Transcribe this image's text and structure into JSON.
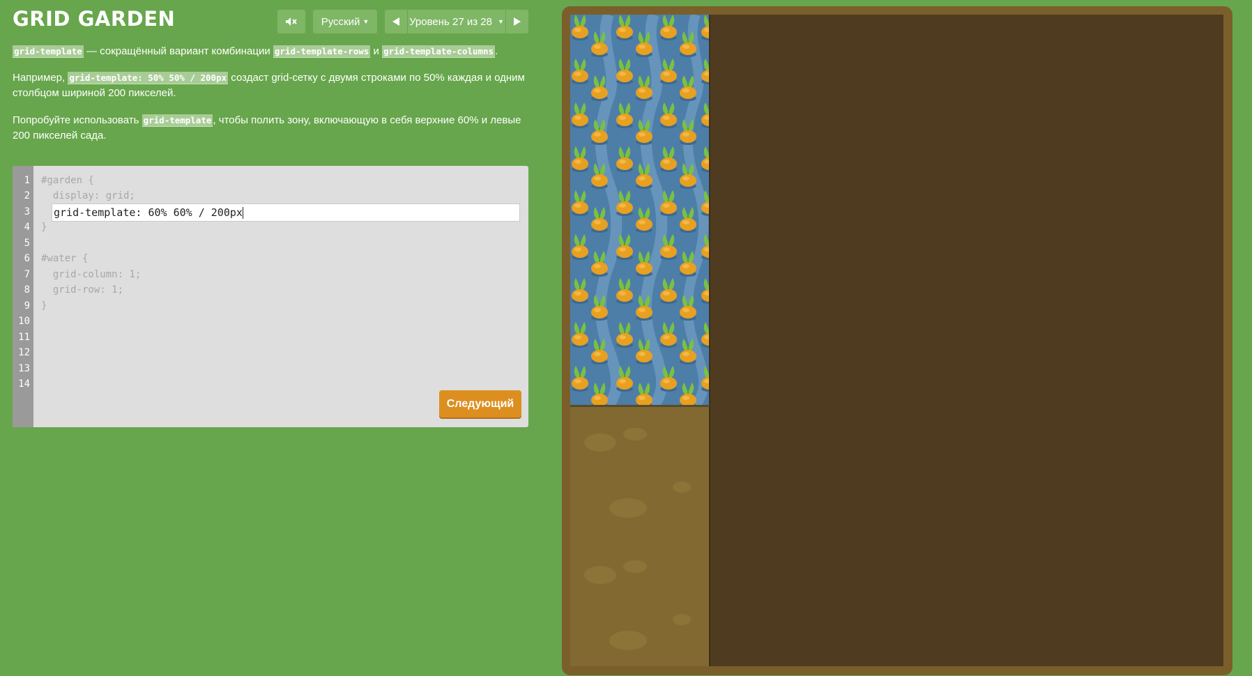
{
  "header": {
    "title": "GRID GARDEN",
    "mute_icon": "speaker-mute-icon",
    "language": "Русский",
    "level_text": "Уровень 27 из 28",
    "prev_icon": "triangle-left-icon",
    "next_icon": "triangle-right-icon"
  },
  "instructions": {
    "p1_code1": "grid-template",
    "p1_text1": " — сокращённый вариант комбинации ",
    "p1_code2": "grid-template-rows",
    "p1_text2": " и ",
    "p1_code3": "grid-template-columns",
    "p1_text3": ".",
    "p2_text1": "Например, ",
    "p2_code1": "grid-template: 50% 50% / 200px",
    "p2_text2": " создаст grid-сетку с двумя строками по 50% каждая и одним столбцом шириной 200 пикселей.",
    "p3_text1": "Попробуйте использовать ",
    "p3_code1": "grid-template",
    "p3_text2": ", чтобы полить зону, включающую в себя верхние 60% и левые 200 пикселей сада."
  },
  "editor": {
    "line_numbers": [
      "1",
      "2",
      "3",
      "4",
      "5",
      "6",
      "7",
      "8",
      "9",
      "10",
      "11",
      "12",
      "13",
      "14"
    ],
    "line1": "#garden {",
    "line2": "  display: grid;",
    "input_value": "grid-template: 60% 60% / 200px",
    "line4": "}",
    "line6": "#water {",
    "line7": "  grid-column: 1;",
    "line8": "  grid-row: 1;",
    "line9": "}",
    "next_label": "Следующий"
  },
  "garden": {
    "colors": {
      "frame": "#7b5f2b",
      "dirt": "#4f3b1f",
      "water": "#4d7ea8",
      "soil": "#816931",
      "carrot": "#e8a020",
      "leaf": "#7ac142"
    },
    "tile_icon": "carrot-icon"
  }
}
